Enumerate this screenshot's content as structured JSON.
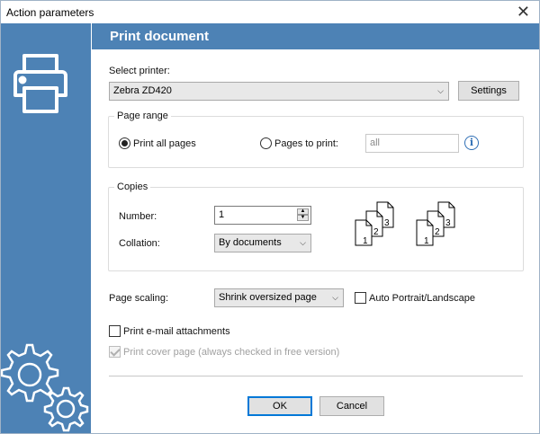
{
  "window": {
    "title": "Action parameters",
    "close_glyph": "✕"
  },
  "header": {
    "title": "Print document"
  },
  "printer": {
    "label": "Select printer:",
    "selected": "Zebra ZD420",
    "settings_label": "Settings"
  },
  "page_range": {
    "legend": "Page range",
    "all_pages_label": "Print all pages",
    "pages_to_print_label": "Pages to print:",
    "pages_value": "all",
    "selected": "all_pages",
    "info_glyph": "i"
  },
  "copies": {
    "legend": "Copies",
    "number_label": "Number:",
    "number_value": "1",
    "collation_label": "Collation:",
    "collation_value": "By documents",
    "stack_page_numbers": [
      "1",
      "2",
      "3"
    ]
  },
  "scaling": {
    "label": "Page scaling:",
    "value": "Shrink oversized page",
    "auto_orientation_label": "Auto Portrait/Landscape",
    "auto_orientation_checked": false
  },
  "options": {
    "email_attachments_label": "Print e-mail attachments",
    "email_attachments_checked": false,
    "cover_page_label": "Print cover page (always checked in free version)",
    "cover_page_checked": true,
    "cover_page_disabled": true
  },
  "buttons": {
    "ok": "OK",
    "cancel": "Cancel"
  },
  "colors": {
    "accent": "#4d82b5",
    "default_button_border": "#0078d7",
    "info": "#2f6fb5"
  }
}
